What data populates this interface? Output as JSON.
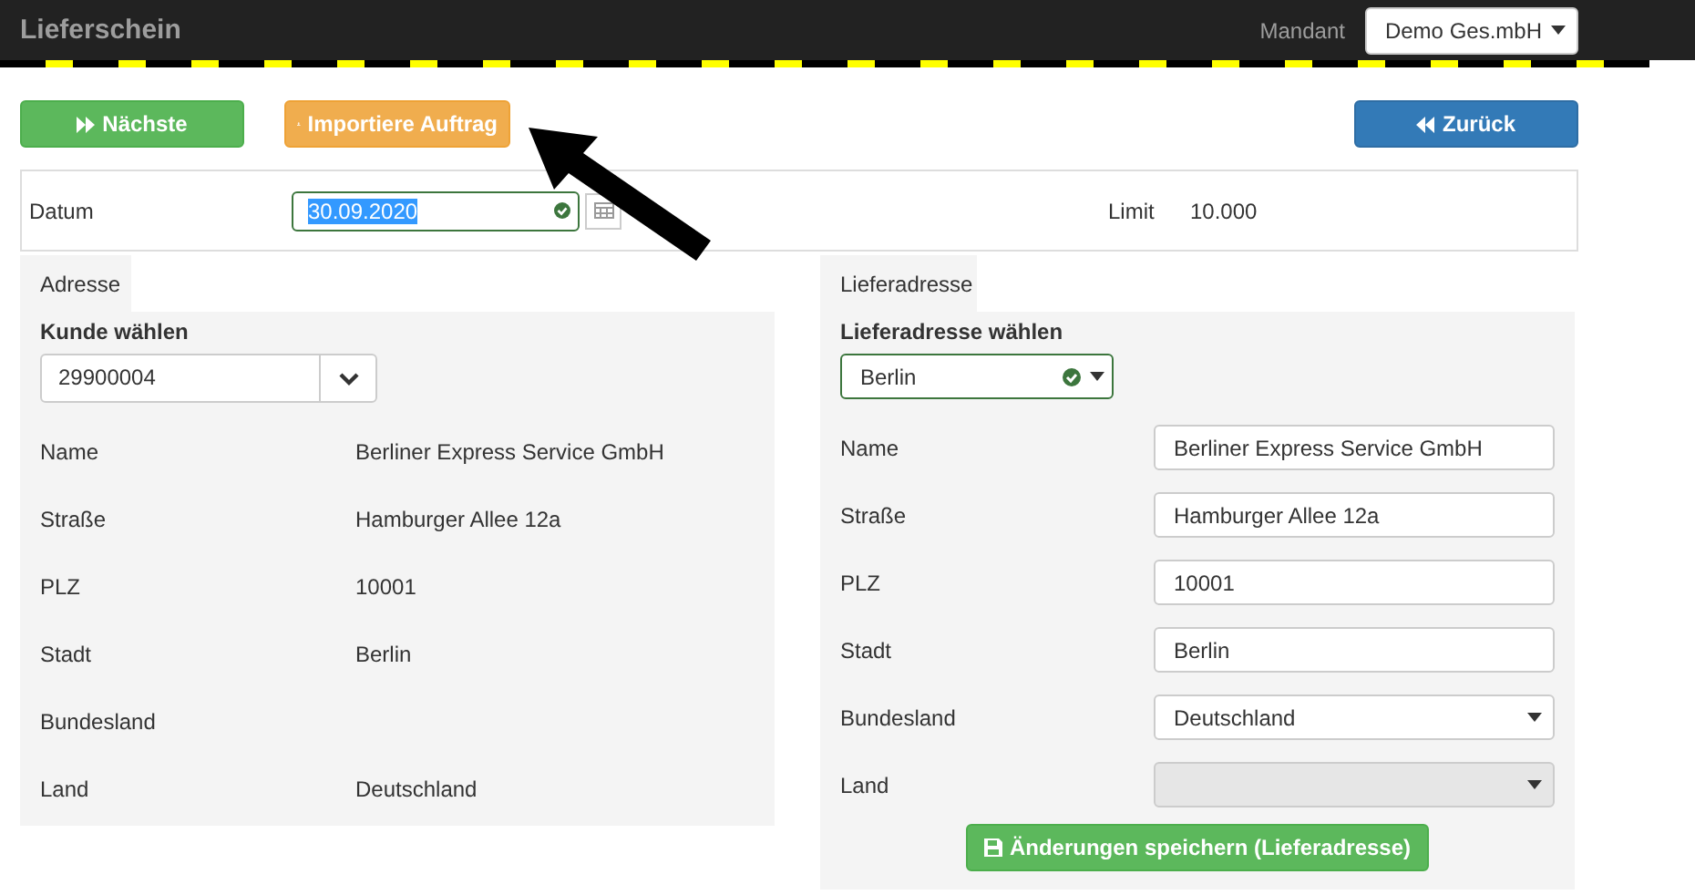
{
  "header": {
    "title": "Lieferschein",
    "mandant_label": "Mandant",
    "mandant_value": "Demo Ges.mbH"
  },
  "toolbar": [
    {
      "label": "Nächste",
      "kind": "next"
    },
    {
      "label": "Importiere Auftrag",
      "kind": "import"
    },
    {
      "label": "Zurück",
      "kind": "back"
    }
  ],
  "datum": {
    "label": "Datum",
    "value": "30.09.2020",
    "limit_label": "Limit",
    "limit_value": "10.000"
  },
  "address": {
    "tab": "Adresse",
    "select_label": "Kunde wählen",
    "select_value": "29900004",
    "fields": [
      {
        "label": "Name",
        "value": "Berliner Express Service GmbH"
      },
      {
        "label": "Straße",
        "value": "Hamburger Allee 12a"
      },
      {
        "label": "PLZ",
        "value": "10001"
      },
      {
        "label": "Stadt",
        "value": "Berlin"
      },
      {
        "label": "Bundesland"
      },
      {
        "label": "Land",
        "value": "Deutschland"
      }
    ]
  },
  "delivery": {
    "tab": "Lieferadresse",
    "select_label": "Lieferadresse wählen",
    "select_value": "Berlin",
    "fields": [
      {
        "label": "Name",
        "value": "Berliner Express Service GmbH",
        "kind": "input",
        "disabled": false
      },
      {
        "label": "Straße",
        "value": "Hamburger Allee 12a",
        "kind": "input",
        "disabled": false
      },
      {
        "label": "PLZ",
        "value": "10001",
        "kind": "input",
        "disabled": false
      },
      {
        "label": "Stadt",
        "value": "Berlin",
        "kind": "input",
        "disabled": false
      },
      {
        "label": "Bundesland",
        "value": "Deutschland",
        "kind": "select",
        "disabled": false
      },
      {
        "label": "Land",
        "kind": "select",
        "disabled": true
      }
    ],
    "save_button": "Änderungen speichern (Lieferadresse)"
  }
}
